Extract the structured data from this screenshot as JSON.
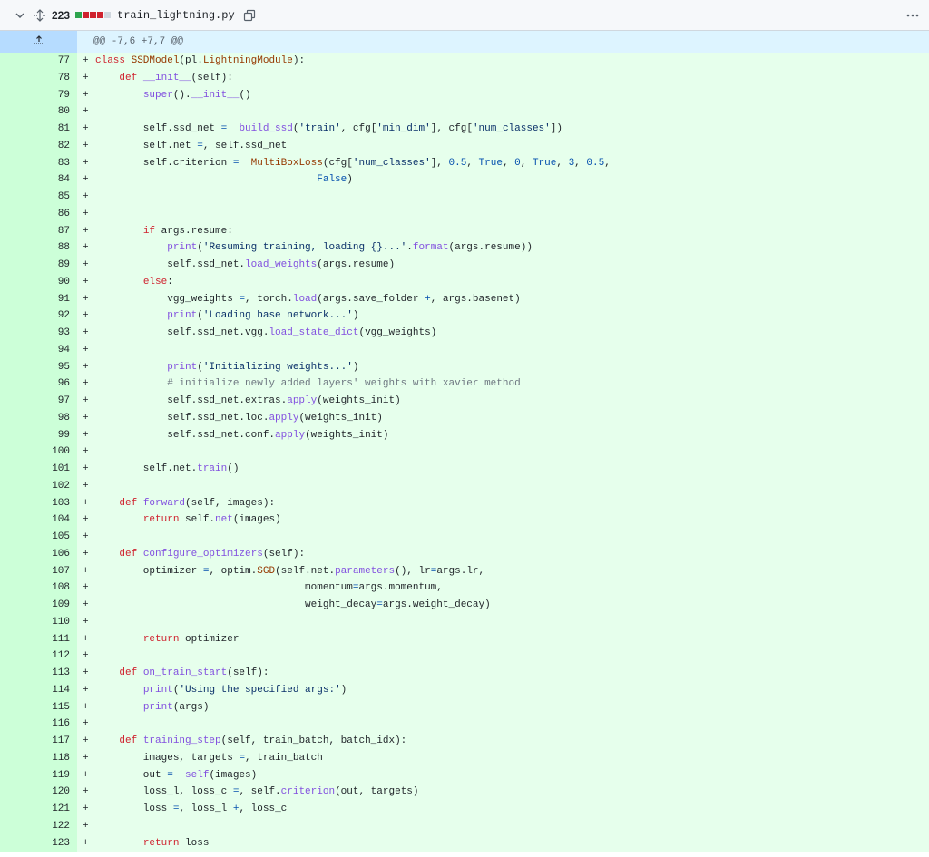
{
  "header": {
    "changes_count": "223",
    "filename": "train_lightning.py",
    "diffstat_colors": [
      "#2da44e",
      "#cf222e",
      "#cf222e",
      "#cf222e",
      "#d0d7de"
    ]
  },
  "hunk": {
    "header_text": "@@ -7,6 +7,7 @@"
  },
  "diff_lines": [
    {
      "num": "77",
      "marker": "+",
      "tokens": [
        [
          "kw",
          "class "
        ],
        [
          "cls",
          "SSDModel"
        ],
        [
          "",
          "(pl."
        ],
        [
          "cls",
          "LightningModule"
        ],
        [
          "",
          "):"
        ]
      ]
    },
    {
      "num": "78",
      "marker": "+",
      "tokens": [
        [
          "",
          "    "
        ],
        [
          "kw",
          "def "
        ],
        [
          "fn",
          "__init__"
        ],
        [
          "",
          "(self):"
        ]
      ]
    },
    {
      "num": "79",
      "marker": "+",
      "tokens": [
        [
          "",
          "        "
        ],
        [
          "fn",
          "super"
        ],
        [
          "",
          "()."
        ],
        [
          "fn",
          "__init__"
        ],
        [
          "",
          "()"
        ]
      ]
    },
    {
      "num": "80",
      "marker": "+",
      "tokens": []
    },
    {
      "num": "81",
      "marker": "+",
      "tokens": [
        [
          "",
          "        self.ssd_net "
        ],
        [
          "op",
          "="
        ],
        [
          "",
          "  "
        ],
        [
          "fn",
          "build_ssd"
        ],
        [
          "",
          "("
        ],
        [
          "str",
          "'train'"
        ],
        [
          "",
          ", cfg["
        ],
        [
          "str",
          "'min_dim'"
        ],
        [
          "",
          "], cfg["
        ],
        [
          "str",
          "'num_classes'"
        ],
        [
          "",
          "])"
        ]
      ]
    },
    {
      "num": "82",
      "marker": "+",
      "tokens": [
        [
          "",
          "        self.net "
        ],
        [
          "op",
          "="
        ],
        [
          "",
          ", self.ssd_net"
        ]
      ]
    },
    {
      "num": "83",
      "marker": "+",
      "tokens": [
        [
          "",
          "        self.criterion "
        ],
        [
          "op",
          "="
        ],
        [
          "",
          "  "
        ],
        [
          "cls",
          "MultiBoxLoss"
        ],
        [
          "",
          "(cfg["
        ],
        [
          "str",
          "'num_classes'"
        ],
        [
          "",
          "], "
        ],
        [
          "num-lit",
          "0.5"
        ],
        [
          "",
          ", "
        ],
        [
          "num-lit",
          "True"
        ],
        [
          "",
          ", "
        ],
        [
          "num-lit",
          "0"
        ],
        [
          "",
          ", "
        ],
        [
          "num-lit",
          "True"
        ],
        [
          "",
          ", "
        ],
        [
          "num-lit",
          "3"
        ],
        [
          "",
          ", "
        ],
        [
          "num-lit",
          "0.5"
        ],
        [
          "",
          ","
        ]
      ]
    },
    {
      "num": "84",
      "marker": "+",
      "tokens": [
        [
          "",
          "                                     "
        ],
        [
          "num-lit",
          "False"
        ],
        [
          "",
          ")"
        ]
      ]
    },
    {
      "num": "85",
      "marker": "+",
      "tokens": []
    },
    {
      "num": "86",
      "marker": "+",
      "tokens": []
    },
    {
      "num": "87",
      "marker": "+",
      "tokens": [
        [
          "",
          "        "
        ],
        [
          "kw",
          "if "
        ],
        [
          "",
          "args.resume:"
        ]
      ]
    },
    {
      "num": "88",
      "marker": "+",
      "tokens": [
        [
          "",
          "            "
        ],
        [
          "fn",
          "print"
        ],
        [
          "",
          "("
        ],
        [
          "str",
          "'Resuming training, loading {}...'"
        ],
        [
          "",
          "."
        ],
        [
          "fn",
          "format"
        ],
        [
          "",
          "(args.resume))"
        ]
      ]
    },
    {
      "num": "89",
      "marker": "+",
      "tokens": [
        [
          "",
          "            self.ssd_net."
        ],
        [
          "fn",
          "load_weights"
        ],
        [
          "",
          "(args.resume)"
        ]
      ]
    },
    {
      "num": "90",
      "marker": "+",
      "tokens": [
        [
          "",
          "        "
        ],
        [
          "kw",
          "else"
        ],
        [
          "",
          ":"
        ]
      ]
    },
    {
      "num": "91",
      "marker": "+",
      "tokens": [
        [
          "",
          "            vgg_weights "
        ],
        [
          "op",
          "="
        ],
        [
          "",
          ", torch."
        ],
        [
          "fn",
          "load"
        ],
        [
          "",
          "(args.save_folder "
        ],
        [
          "op",
          "+"
        ],
        [
          "",
          ", args.basenet)"
        ]
      ]
    },
    {
      "num": "92",
      "marker": "+",
      "tokens": [
        [
          "",
          "            "
        ],
        [
          "fn",
          "print"
        ],
        [
          "",
          "("
        ],
        [
          "str",
          "'Loading base network...'"
        ],
        [
          "",
          ")"
        ]
      ]
    },
    {
      "num": "93",
      "marker": "+",
      "tokens": [
        [
          "",
          "            self.ssd_net.vgg."
        ],
        [
          "fn",
          "load_state_dict"
        ],
        [
          "",
          "(vgg_weights)"
        ]
      ]
    },
    {
      "num": "94",
      "marker": "+",
      "tokens": []
    },
    {
      "num": "95",
      "marker": "+",
      "tokens": [
        [
          "",
          "            "
        ],
        [
          "fn",
          "print"
        ],
        [
          "",
          "("
        ],
        [
          "str",
          "'Initializing weights...'"
        ],
        [
          "",
          ")"
        ]
      ]
    },
    {
      "num": "96",
      "marker": "+",
      "tokens": [
        [
          "",
          "            "
        ],
        [
          "cmt",
          "# initialize newly added layers' weights with xavier method"
        ]
      ]
    },
    {
      "num": "97",
      "marker": "+",
      "tokens": [
        [
          "",
          "            self.ssd_net.extras."
        ],
        [
          "fn",
          "apply"
        ],
        [
          "",
          "(weights_init)"
        ]
      ]
    },
    {
      "num": "98",
      "marker": "+",
      "tokens": [
        [
          "",
          "            self.ssd_net.loc."
        ],
        [
          "fn",
          "apply"
        ],
        [
          "",
          "(weights_init)"
        ]
      ]
    },
    {
      "num": "99",
      "marker": "+",
      "tokens": [
        [
          "",
          "            self.ssd_net.conf."
        ],
        [
          "fn",
          "apply"
        ],
        [
          "",
          "(weights_init)"
        ]
      ]
    },
    {
      "num": "100",
      "marker": "+",
      "tokens": []
    },
    {
      "num": "101",
      "marker": "+",
      "tokens": [
        [
          "",
          "        self.net."
        ],
        [
          "fn",
          "train"
        ],
        [
          "",
          "()"
        ]
      ]
    },
    {
      "num": "102",
      "marker": "+",
      "tokens": []
    },
    {
      "num": "103",
      "marker": "+",
      "tokens": [
        [
          "",
          "    "
        ],
        [
          "kw",
          "def "
        ],
        [
          "fn",
          "forward"
        ],
        [
          "",
          "(self, images):"
        ]
      ]
    },
    {
      "num": "104",
      "marker": "+",
      "tokens": [
        [
          "",
          "        "
        ],
        [
          "kw",
          "return "
        ],
        [
          "",
          "self."
        ],
        [
          "fn",
          "net"
        ],
        [
          "",
          "(images)"
        ]
      ]
    },
    {
      "num": "105",
      "marker": "+",
      "tokens": []
    },
    {
      "num": "106",
      "marker": "+",
      "tokens": [
        [
          "",
          "    "
        ],
        [
          "kw",
          "def "
        ],
        [
          "fn",
          "configure_optimizers"
        ],
        [
          "",
          "(self):"
        ]
      ]
    },
    {
      "num": "107",
      "marker": "+",
      "tokens": [
        [
          "",
          "        optimizer "
        ],
        [
          "op",
          "="
        ],
        [
          "",
          ", optim."
        ],
        [
          "cls",
          "SGD"
        ],
        [
          "",
          "(self.net."
        ],
        [
          "fn",
          "parameters"
        ],
        [
          "",
          "(), lr"
        ],
        [
          "op",
          "="
        ],
        [
          "",
          "args.lr,"
        ]
      ]
    },
    {
      "num": "108",
      "marker": "+",
      "tokens": [
        [
          "",
          "                                   momentum"
        ],
        [
          "op",
          "="
        ],
        [
          "",
          "args.momentum,"
        ]
      ]
    },
    {
      "num": "109",
      "marker": "+",
      "tokens": [
        [
          "",
          "                                   weight_decay"
        ],
        [
          "op",
          "="
        ],
        [
          "",
          "args.weight_decay)"
        ]
      ]
    },
    {
      "num": "110",
      "marker": "+",
      "tokens": []
    },
    {
      "num": "111",
      "marker": "+",
      "tokens": [
        [
          "",
          "        "
        ],
        [
          "kw",
          "return "
        ],
        [
          "",
          "optimizer"
        ]
      ]
    },
    {
      "num": "112",
      "marker": "+",
      "tokens": []
    },
    {
      "num": "113",
      "marker": "+",
      "tokens": [
        [
          "",
          "    "
        ],
        [
          "kw",
          "def "
        ],
        [
          "fn",
          "on_train_start"
        ],
        [
          "",
          "(self):"
        ]
      ]
    },
    {
      "num": "114",
      "marker": "+",
      "tokens": [
        [
          "",
          "        "
        ],
        [
          "fn",
          "print"
        ],
        [
          "",
          "("
        ],
        [
          "str",
          "'Using the specified args:'"
        ],
        [
          "",
          ")"
        ]
      ]
    },
    {
      "num": "115",
      "marker": "+",
      "tokens": [
        [
          "",
          "        "
        ],
        [
          "fn",
          "print"
        ],
        [
          "",
          "(args)"
        ]
      ]
    },
    {
      "num": "116",
      "marker": "+",
      "tokens": []
    },
    {
      "num": "117",
      "marker": "+",
      "tokens": [
        [
          "",
          "    "
        ],
        [
          "kw",
          "def "
        ],
        [
          "fn",
          "training_step"
        ],
        [
          "",
          "(self, train_batch, batch_idx):"
        ]
      ]
    },
    {
      "num": "118",
      "marker": "+",
      "tokens": [
        [
          "",
          "        images, targets "
        ],
        [
          "op",
          "="
        ],
        [
          "",
          ", train_batch"
        ]
      ]
    },
    {
      "num": "119",
      "marker": "+",
      "tokens": [
        [
          "",
          "        out "
        ],
        [
          "op",
          "="
        ],
        [
          "",
          "  "
        ],
        [
          "fn",
          "self"
        ],
        [
          "",
          "(images)"
        ]
      ]
    },
    {
      "num": "120",
      "marker": "+",
      "tokens": [
        [
          "",
          "        loss_l, loss_c "
        ],
        [
          "op",
          "="
        ],
        [
          "",
          ", self."
        ],
        [
          "fn",
          "criterion"
        ],
        [
          "",
          "(out, targets)"
        ]
      ]
    },
    {
      "num": "121",
      "marker": "+",
      "tokens": [
        [
          "",
          "        loss "
        ],
        [
          "op",
          "="
        ],
        [
          "",
          ", loss_l "
        ],
        [
          "op",
          "+"
        ],
        [
          "",
          ", loss_c"
        ]
      ]
    },
    {
      "num": "122",
      "marker": "+",
      "tokens": []
    },
    {
      "num": "123",
      "marker": "+",
      "tokens": [
        [
          "",
          "        "
        ],
        [
          "kw",
          "return "
        ],
        [
          "",
          "loss"
        ]
      ]
    }
  ]
}
